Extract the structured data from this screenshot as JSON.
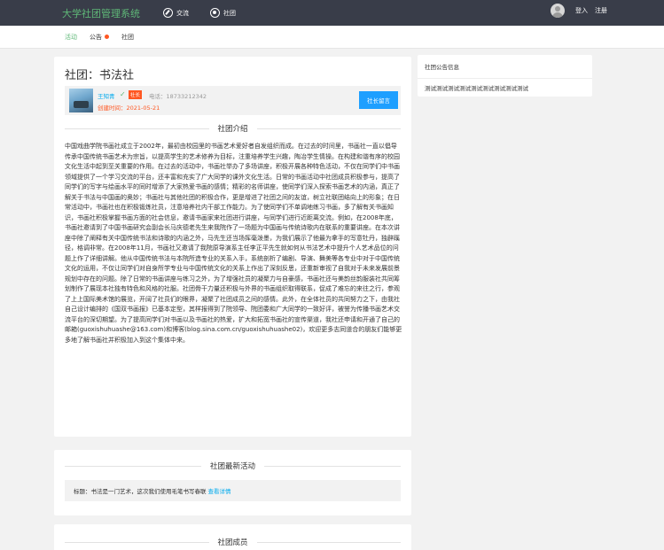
{
  "header": {
    "brand": "大学社团管理系统",
    "nav": [
      {
        "label": "交流",
        "icon": "compass-icon"
      },
      {
        "label": "社团",
        "icon": "globe-icon"
      }
    ],
    "login": "登入",
    "register": "注册"
  },
  "subnav": {
    "items": [
      {
        "label": "活动",
        "active": true
      },
      {
        "label": "公告",
        "active": false,
        "dot": true
      },
      {
        "label": "社团",
        "active": false
      }
    ]
  },
  "club": {
    "title": "社团：书法社",
    "leader_name": "王知青",
    "leader_tag": "社长",
    "phone": "电话：18733212342",
    "created": "创建时间：2021-05-21",
    "message_button": "社长留言"
  },
  "intro": {
    "heading": "社团介绍",
    "text": "中国戏曲学院书画社成立于2002年，最初由校园里的书画艺术爱好者自发组织而成。在过去的时间里，书画社一直以倡导传承中国传统书画艺术为宗旨，以提高学生的艺术修养为目标，注重培养学生兴趣，陶冶学生情操。在构建和谐有序的校园文化生活中起到至关重要的作用。在过去的活动中，书画社举办了多场讲座，积极开展各种特色活动，不仅在同学们中书画领域提供了一个学习交流的平台，还丰富和充实了广大同学的课外文化生活。日常的书画活动中社团成员积极参与，提高了同学们的写字与绘画水平的同时增添了大家热爱书画的感情；精彩的名师讲座，使同学们深入探索书画艺术的内涵，真正了解关于书法与中国画的奥妙；书画社与其他社团的积极合作，更是增进了社团之间的友谊，树立社联团结向上的形象；在日常活动中，书画社也在积极锻炼社员，注意培养社内干部工作能力。为了使同学们不单调地练习书画，多了解有关书画知识，书画社积极掌握书画方面的社会信息，邀请书画家来社团进行讲座，与同学们进行近距离交流。例如，在2008年底，书画社邀请到了中国书画研究会副会长马庆德老先生来我院作了一场题为中国画与传统诗歌内在联系的重要讲座。在本次讲座中除了阐释有关中国传统书法和诗歌的内涵之外，马先生还当场挥毫泼墨，为我们展示了他最为拿手的写意牡丹，独辟蹊径，格调非常。在2008年11月，书画社又邀请了我院原导演系主任李正平先生就如何从书法艺术中提升个人艺术品位的问题上作了详细讲解。他从中国传统书法与本院所造专业的关系入手，系统剖析了编剧、导演、舞美等各专业中对于中国传统文化的运用，不仅让同学们对自身所学专业与中国传统文化的关系上作出了深刻反思，还重新审视了自我对于未来发展前景规划中存在的问题。除了日常的书画讲座与练习之外，为了增强社员的凝聚力与自豪感，书画社还与美韵丝韵服装社共同筹划制作了展现本社独有特色和风格的社服。社团骨干力量还积极与外界的书画组织取得联系，促成了难忘的来往之行，参观了上上国际美术馆的展览，开阔了社员们的眼界，凝聚了社团成员之间的感情。此外，在全体社员的共同努力之下，由我社自己设计编排的《国双书画报》已基本定型，其样报得到了院领导、院团委和广大同学的一致好评，被誉为传播书画艺术交流平台的深切期望。为了提高同学们对书画以及书画社的热爱，扩大和拓宽书画社的宣传渠道，我社还申请和开通了自己的邮箱(guoxishuhuashe@163.com)和博客(blog.sina.com.cn/guoxishuhuashe02)，欢迎更多志同道合的朋友们能够更多地了解书画社并积极加入到这个集体中来。"
  },
  "news": {
    "heading": "社团最新活动",
    "item_text": "标题：书法是一门艺术，这次我们使用毛笔书写春联",
    "item_link": "查看详情"
  },
  "members": {
    "heading": "社团成员"
  },
  "sidebar": {
    "title": "社团公告信息",
    "content": "测试测试测试测试测试测试测试测试测试"
  }
}
